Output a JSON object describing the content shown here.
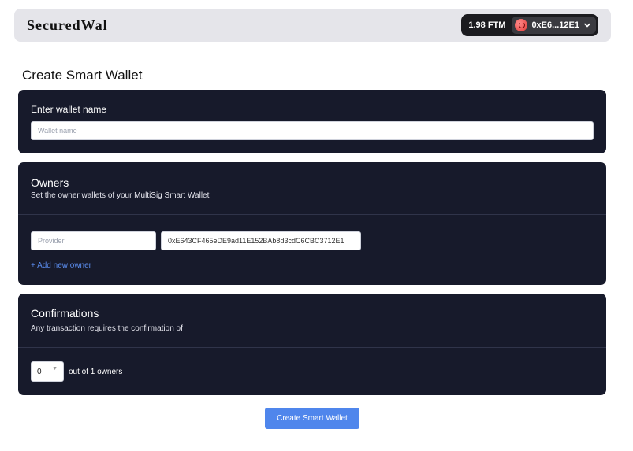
{
  "header": {
    "brand": "SecuredWal",
    "balance": "1.98 FTM",
    "address": "0xE6...12E1",
    "icons": {
      "avatar": "account-avatar-icon",
      "chevron": "chevron-down-icon"
    }
  },
  "page": {
    "title": "Create Smart Wallet"
  },
  "wallet_name": {
    "label": "Enter wallet name",
    "placeholder": "Wallet name"
  },
  "owners": {
    "title": "Owners",
    "subtitle": "Set the owner wallets of your MultiSig Smart Wallet",
    "provider_placeholder": "Provider",
    "address_value": "0xE643CF465eDE9ad11E152BAb8d3cdC6CBC3712E1",
    "add_label": "+ Add new owner"
  },
  "confirmations": {
    "title": "Confirmations",
    "subtitle": "Any transaction requires the confirmation of",
    "selected": "0",
    "out_of": "out of 1 owners"
  },
  "actions": {
    "create_label": "Create Smart Wallet"
  },
  "colors": {
    "topbar": "#e5e5ea",
    "card": "#171a2b",
    "accent": "#4f86ec",
    "link": "#5b8def"
  }
}
